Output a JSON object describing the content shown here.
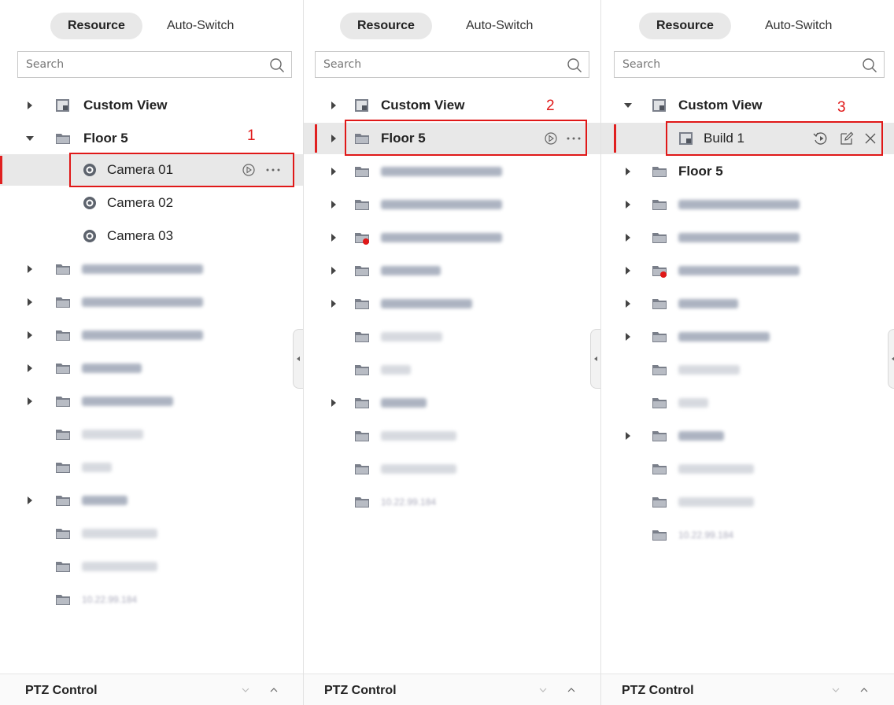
{
  "panels": [
    {
      "tabs": {
        "resource": "Resource",
        "auto_switch": "Auto-Switch"
      },
      "search_placeholder": "Search",
      "tree": {
        "custom_view": "Custom View",
        "floor5": "Floor 5",
        "cameras": [
          "Camera 01",
          "Camera 02",
          "Camera 03"
        ],
        "blurred_count": 11,
        "last_ip": "10.22.99.184"
      },
      "callout": "1",
      "footer": "PTZ Control"
    },
    {
      "tabs": {
        "resource": "Resource",
        "auto_switch": "Auto-Switch"
      },
      "search_placeholder": "Search",
      "tree": {
        "custom_view": "Custom View",
        "floor5": "Floor 5",
        "last_ip": "10.22.99.184"
      },
      "callout": "2",
      "footer": "PTZ Control"
    },
    {
      "tabs": {
        "resource": "Resource",
        "auto_switch": "Auto-Switch"
      },
      "search_placeholder": "Search",
      "tree": {
        "custom_view": "Custom View",
        "build1": "Build 1",
        "floor5": "Floor 5",
        "last_ip": "10.22.99.184"
      },
      "callout": "3",
      "footer": "PTZ Control"
    }
  ],
  "colors": {
    "accent": "#e01818",
    "selected_bg": "#e8e8e8",
    "folder": "#7a7f8a"
  },
  "icons": [
    "search-icon",
    "expand-arrow-icon",
    "collapse-arrow-icon",
    "custom-view-icon",
    "folder-icon",
    "alarm-folder-icon",
    "camera-icon",
    "play-icon",
    "more-icon",
    "playback-icon",
    "edit-icon",
    "close-icon",
    "chevron-down-icon",
    "chevron-up-icon"
  ]
}
